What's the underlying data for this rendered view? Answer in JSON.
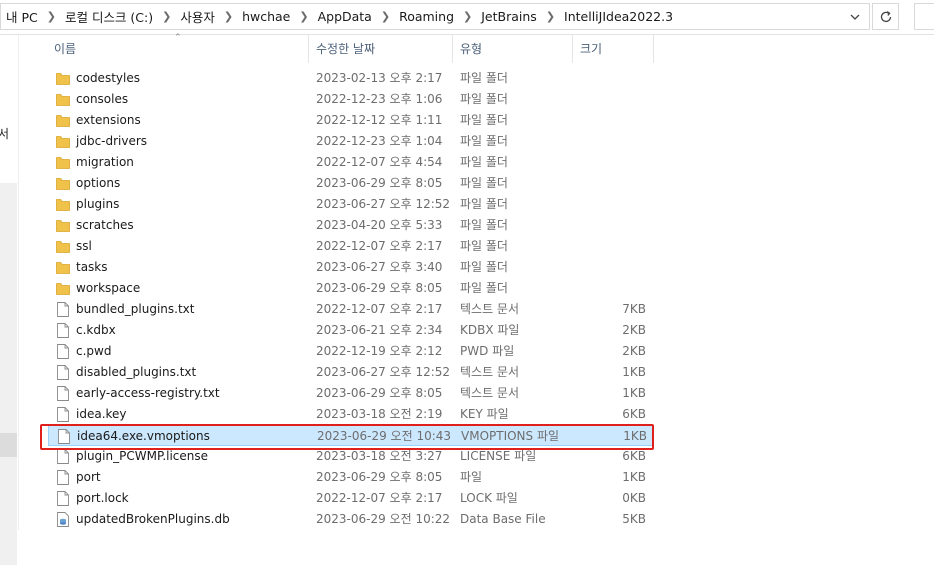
{
  "address_bar": {
    "breadcrumbs": [
      "내 PC",
      "로컬 디스크 (C:)",
      "사용자",
      "hwchae",
      "AppData",
      "Roaming",
      "JetBrains",
      "IntelliJIdea2022.3"
    ],
    "separator_icon": "chevron-right-icon",
    "dropdown_icon": "chevron-down-icon",
    "refresh_icon": "refresh-icon"
  },
  "nav_pane": {
    "visible_text": "서"
  },
  "columns": {
    "name": "이름",
    "date": "수정한 날짜",
    "type": "유형",
    "size": "크기",
    "sort_icon": "sort-up-icon"
  },
  "colors": {
    "folder": "#f0c24a",
    "selection_bg": "#cce8ff",
    "selection_border": "#99d1ff",
    "annotation_red": "#e0201c",
    "header_text": "#4c607a"
  },
  "files": [
    {
      "icon": "folder-icon",
      "name": "codestyles",
      "date": "2023-02-13 오후 2:17",
      "type": "파일 폴더",
      "size": ""
    },
    {
      "icon": "folder-icon",
      "name": "consoles",
      "date": "2022-12-23 오후 1:06",
      "type": "파일 폴더",
      "size": ""
    },
    {
      "icon": "folder-icon",
      "name": "extensions",
      "date": "2022-12-12 오후 1:11",
      "type": "파일 폴더",
      "size": ""
    },
    {
      "icon": "folder-icon",
      "name": "jdbc-drivers",
      "date": "2022-12-23 오후 1:04",
      "type": "파일 폴더",
      "size": ""
    },
    {
      "icon": "folder-icon",
      "name": "migration",
      "date": "2022-12-07 오후 4:54",
      "type": "파일 폴더",
      "size": ""
    },
    {
      "icon": "folder-icon",
      "name": "options",
      "date": "2023-06-29 오후 8:05",
      "type": "파일 폴더",
      "size": ""
    },
    {
      "icon": "folder-icon",
      "name": "plugins",
      "date": "2023-06-27 오후 12:52",
      "type": "파일 폴더",
      "size": ""
    },
    {
      "icon": "folder-icon",
      "name": "scratches",
      "date": "2023-04-20 오후 5:33",
      "type": "파일 폴더",
      "size": ""
    },
    {
      "icon": "folder-icon",
      "name": "ssl",
      "date": "2022-12-07 오후 2:17",
      "type": "파일 폴더",
      "size": ""
    },
    {
      "icon": "folder-icon",
      "name": "tasks",
      "date": "2023-06-27 오후 3:40",
      "type": "파일 폴더",
      "size": ""
    },
    {
      "icon": "folder-icon",
      "name": "workspace",
      "date": "2023-06-29 오후 8:05",
      "type": "파일 폴더",
      "size": ""
    },
    {
      "icon": "file-icon",
      "name": "bundled_plugins.txt",
      "date": "2022-12-07 오후 2:17",
      "type": "텍스트 문서",
      "size": "7KB"
    },
    {
      "icon": "file-icon",
      "name": "c.kdbx",
      "date": "2023-06-21 오후 2:34",
      "type": "KDBX 파일",
      "size": "2KB"
    },
    {
      "icon": "file-icon",
      "name": "c.pwd",
      "date": "2022-12-19 오후 2:12",
      "type": "PWD 파일",
      "size": "2KB"
    },
    {
      "icon": "file-icon",
      "name": "disabled_plugins.txt",
      "date": "2023-06-27 오후 12:52",
      "type": "텍스트 문서",
      "size": "1KB"
    },
    {
      "icon": "file-icon",
      "name": "early-access-registry.txt",
      "date": "2023-06-29 오후 8:05",
      "type": "텍스트 문서",
      "size": "1KB"
    },
    {
      "icon": "file-icon",
      "name": "idea.key",
      "date": "2023-03-18 오전 2:19",
      "type": "KEY 파일",
      "size": "6KB"
    },
    {
      "icon": "file-icon",
      "name": "idea64.exe.vmoptions",
      "date": "2023-06-29 오전 10:43",
      "type": "VMOPTIONS 파일",
      "size": "1KB",
      "selected": true
    },
    {
      "icon": "file-icon",
      "name": "plugin_PCWMP.license",
      "date": "2023-03-18 오전 3:27",
      "type": "LICENSE 파일",
      "size": "6KB"
    },
    {
      "icon": "file-icon",
      "name": "port",
      "date": "2023-06-29 오후 8:05",
      "type": "파일",
      "size": "1KB"
    },
    {
      "icon": "file-icon",
      "name": "port.lock",
      "date": "2022-12-07 오후 2:17",
      "type": "LOCK 파일",
      "size": "0KB"
    },
    {
      "icon": "db-file-icon",
      "name": "updatedBrokenPlugins.db",
      "date": "2023-06-29 오전 10:22",
      "type": "Data Base File",
      "size": "5KB"
    }
  ]
}
